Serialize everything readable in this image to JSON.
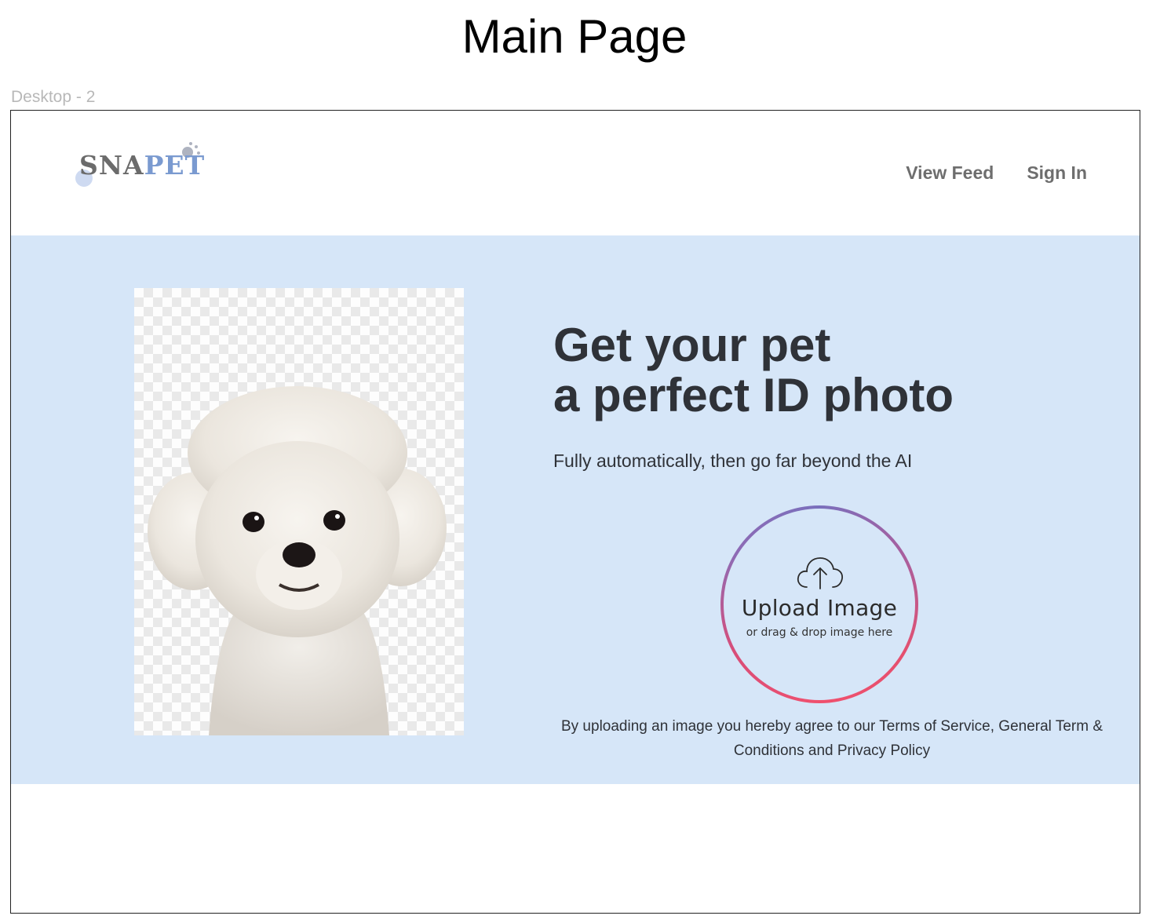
{
  "canvas": {
    "heading": "Main Page",
    "frame_label": "Desktop - 2"
  },
  "brand": {
    "logo_part1": "SNA",
    "logo_part2": "PET",
    "logo_color_dark": "#6b6b6b",
    "logo_color_accent": "#7a9ad0"
  },
  "nav": {
    "items": [
      {
        "label": "View Feed"
      },
      {
        "label": "Sign In"
      }
    ]
  },
  "hero": {
    "background": "#d6e6f8",
    "headline_line1": "Get your pet",
    "headline_line2": "a perfect ID photo",
    "subtitle": "Fully automatically, then go far beyond the AI",
    "image_icon": "pet-photo-bichon",
    "upload": {
      "icon": "cloud-upload-icon",
      "title": "Upload Image",
      "subtitle": "or drag & drop image here",
      "ring_colors": [
        "#f0506e",
        "#8e6bb5"
      ]
    },
    "legal": "By uploading an image you hereby agree to our Terms of Service, General Term & Conditions and Privacy Policy"
  }
}
